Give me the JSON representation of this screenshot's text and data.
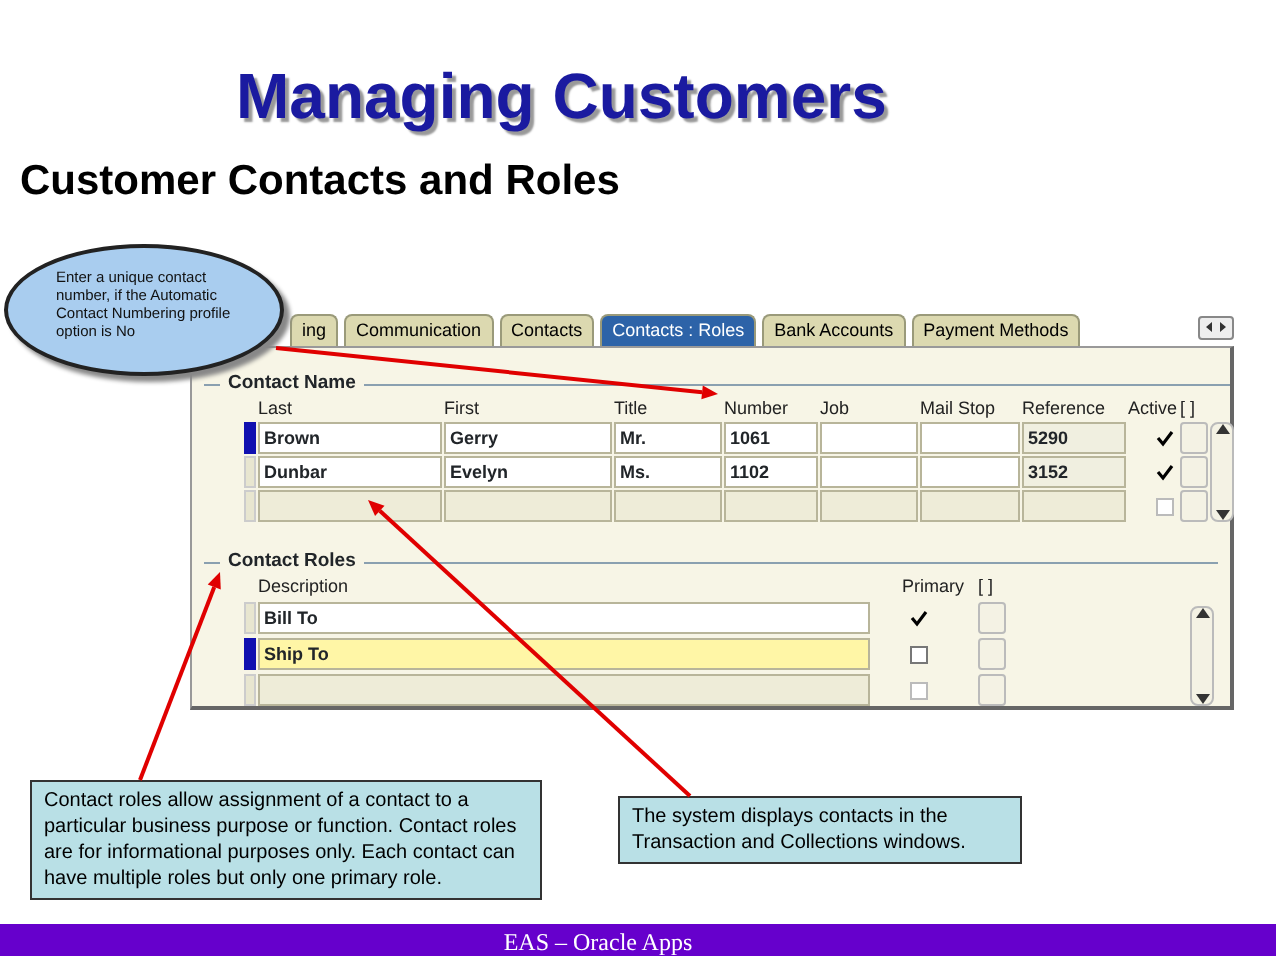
{
  "title": "Managing Customers",
  "subtitle": "Customer Contacts and Roles",
  "callouts": [
    {
      "kind": "ellipse",
      "text": "Enter a unique contact number, if the Automatic Contact Numbering profile option is No"
    },
    {
      "kind": "box",
      "text": "Contact roles allow assignment of a contact to a particular business purpose or function. Contact roles are for informational purposes only. Each contact can have multiple roles but only one primary role."
    },
    {
      "kind": "box",
      "text": "The system displays contacts in the Transaction and Collections windows."
    }
  ],
  "form": {
    "tabs": [
      {
        "label": "ing",
        "selected": false
      },
      {
        "label": "Communication",
        "selected": false
      },
      {
        "label": "Contacts",
        "selected": false
      },
      {
        "label": "Contacts : Roles",
        "selected": true
      },
      {
        "label": "Bank Accounts",
        "selected": false
      },
      {
        "label": "Payment Methods",
        "selected": false
      }
    ],
    "contact_name": {
      "heading": "Contact Name",
      "columns": [
        "Last",
        "First",
        "Title",
        "Number",
        "Job",
        "Mail Stop",
        "Reference",
        "Active",
        "[ ]"
      ],
      "rows": [
        {
          "kind": "record",
          "current": true,
          "last": "Brown",
          "first": "Gerry",
          "title": "Mr.",
          "number": "1061",
          "reference": "5290",
          "active": true
        },
        {
          "kind": "record",
          "current": false,
          "last": "Dunbar",
          "first": "Evelyn",
          "title": "Ms.",
          "number": "1102",
          "reference": "3152",
          "active": true
        },
        {
          "kind": "empty",
          "current": false,
          "active": false
        }
      ]
    },
    "contact_roles": {
      "heading": "Contact Roles",
      "columns": [
        "Description",
        "Primary",
        "[ ]"
      ],
      "rows": [
        {
          "kind": "record",
          "current": false,
          "description": "Bill To",
          "primary": true
        },
        {
          "kind": "record",
          "current": true,
          "description": "Ship To",
          "primary": false
        },
        {
          "kind": "empty",
          "current": false,
          "primary": false
        }
      ]
    }
  },
  "footer": "EAS – Oracle Apps"
}
